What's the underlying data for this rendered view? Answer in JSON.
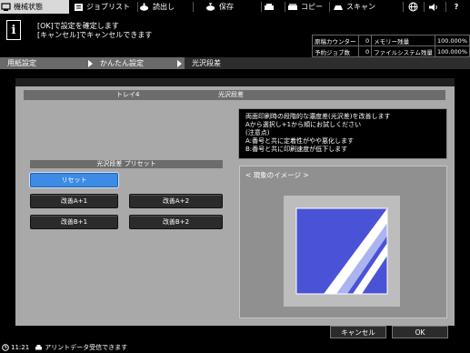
{
  "tabs": [
    {
      "label": "機械状態",
      "icon": "machine-status-icon"
    },
    {
      "label": "ジョブリスト",
      "icon": "job-list-icon"
    },
    {
      "label": "読出し",
      "icon": "read-out-icon"
    },
    {
      "label": "保存",
      "icon": "save-icon"
    },
    {
      "label": "",
      "icon": "fax-print-icon"
    },
    {
      "label": "コピー",
      "icon": "copy-icon"
    },
    {
      "label": "スキャン",
      "icon": "scan-icon"
    },
    {
      "label": "",
      "icon": "globe-icon"
    },
    {
      "label": "",
      "icon": "speaker-icon"
    },
    {
      "label": "",
      "icon": "help-icon"
    }
  ],
  "message": {
    "icon_glyph": "i",
    "line1": "[OK]で設定を確定します",
    "line2": "[キャンセル]でキャンセルできます"
  },
  "status": {
    "original_counter_label": "原稿カウンター",
    "original_counter_value": "0",
    "memory_label": "メモリー残量",
    "memory_value": "100.000%",
    "reserved_jobs_label": "予約ジョブ数",
    "reserved_jobs_value": "0",
    "filesystem_label": "ファイルシステム残量",
    "filesystem_value": "100.000%"
  },
  "breadcrumb": [
    "用紙設定",
    "かんたん設定",
    "光沢段差"
  ],
  "panel": {
    "tray": "トレイ4",
    "title": "光沢段差",
    "preset_label": "光沢段差 プリセット",
    "reset": "リセット",
    "buttons": [
      "改善A+1",
      "改善A+2",
      "改善B+1",
      "改善B+2"
    ]
  },
  "description": [
    "両面印刷時の段階的な濃度差(光沢差)を改善します",
    "Aから選択し+1から順にお試しください",
    "(注意点)",
    "A:番号と共に定着性がやや悪化します",
    "B:番号と共に印刷速度が低下します"
  ],
  "image_caption": "< 現象のイメージ >",
  "footer": {
    "cancel": "キャンセル",
    "ok": "OK"
  },
  "statusbar": {
    "time": "11:21",
    "message": "アリントデータ受信できます"
  },
  "colors": {
    "selected_button": "#3d8be4",
    "illustration_blue": "#4a52d6",
    "illustration_light_blue": "#aab4f0"
  }
}
